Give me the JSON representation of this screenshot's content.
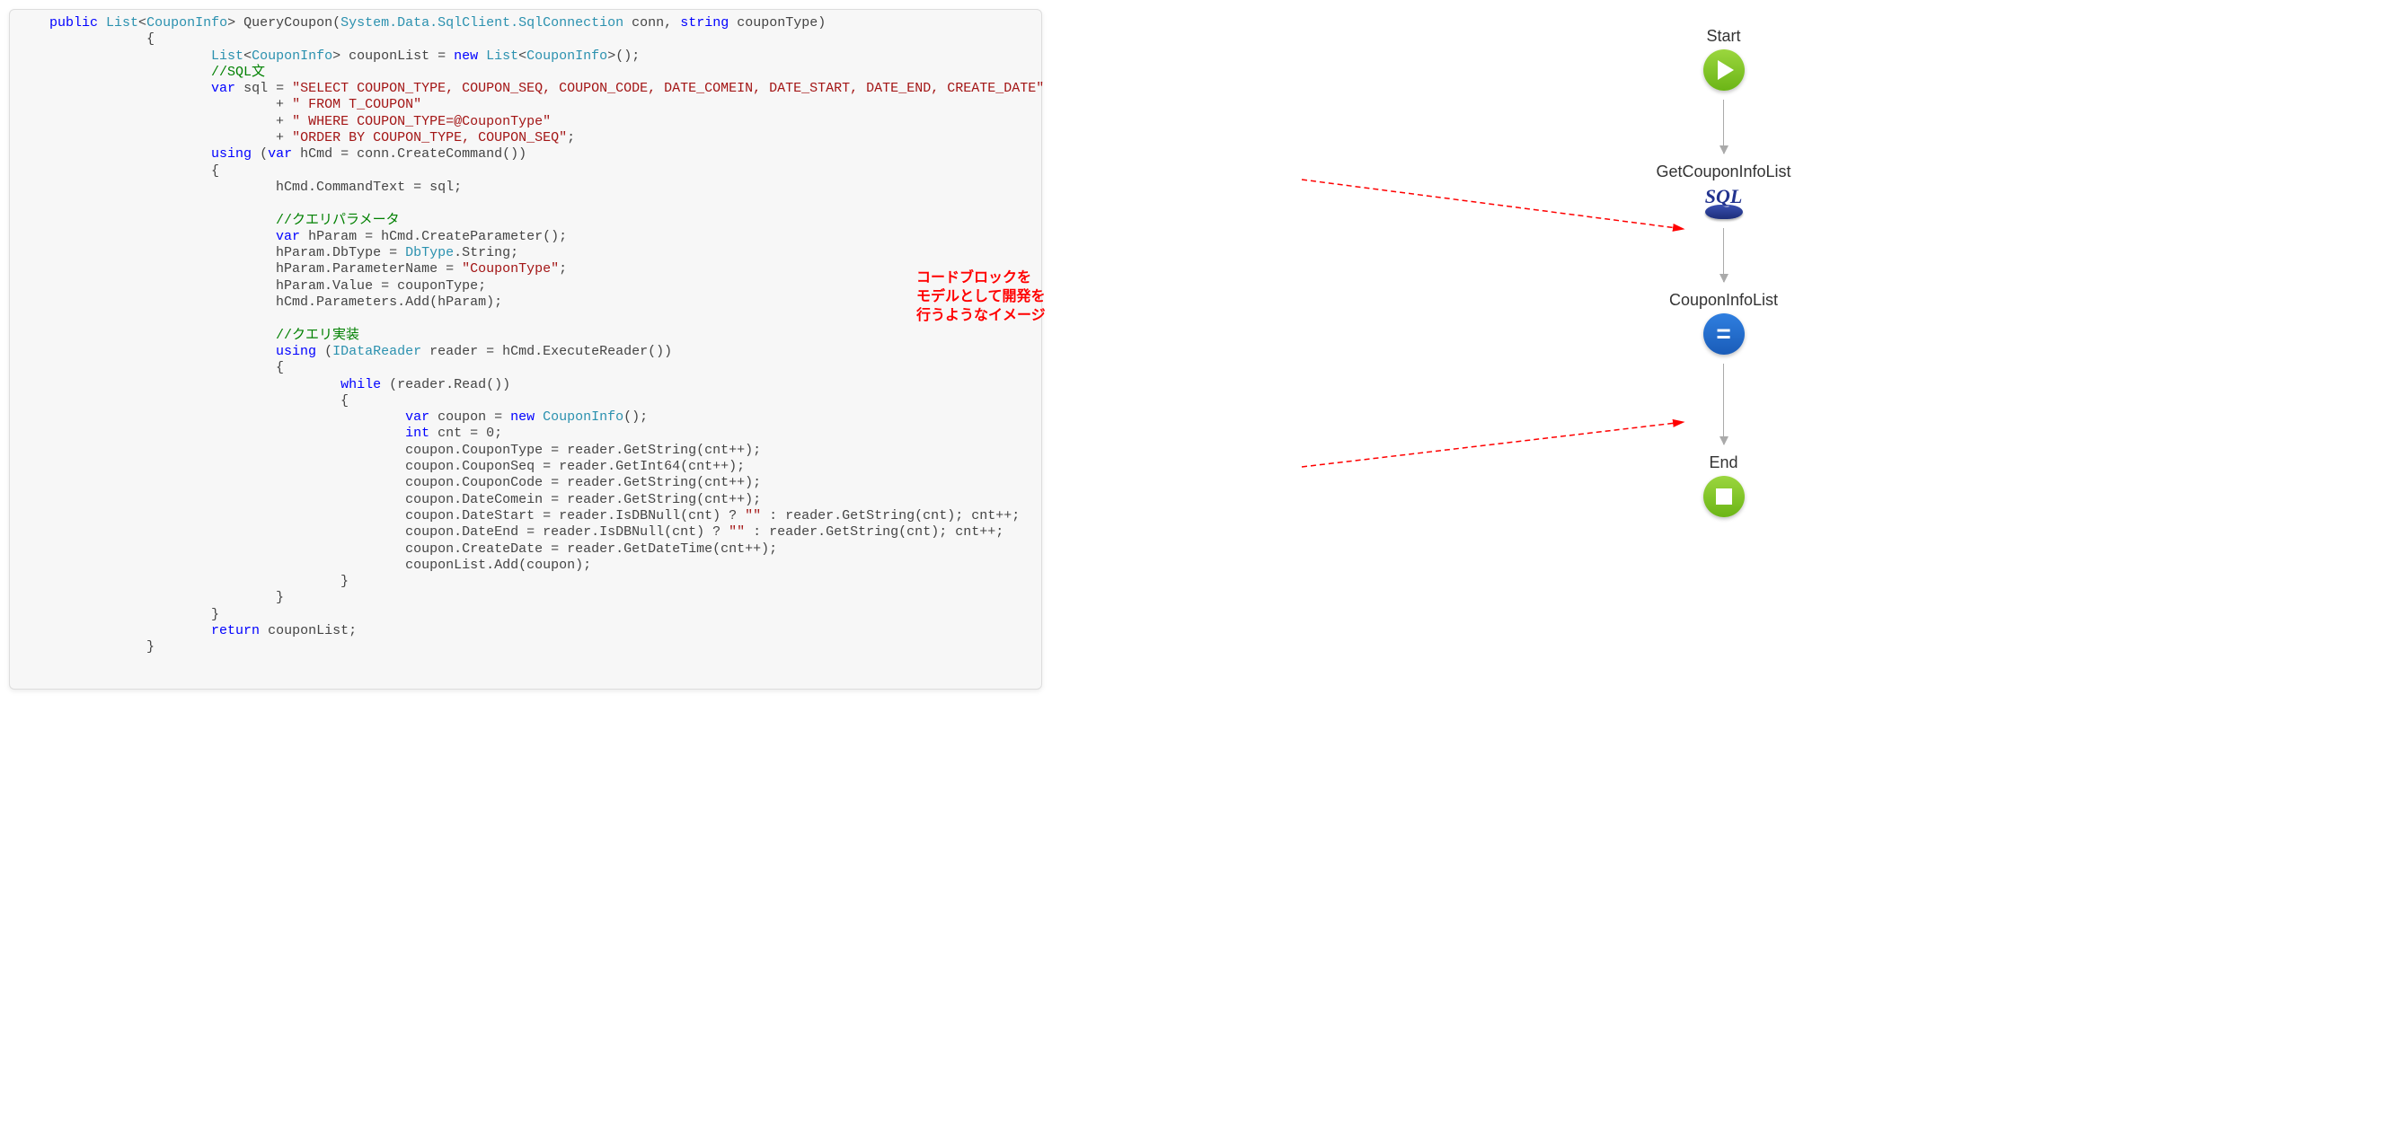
{
  "code_lines": [
    {
      "indent": 1,
      "tokens": [
        {
          "t": "public ",
          "c": "kw"
        },
        {
          "t": "List",
          "c": "type"
        },
        {
          "t": "<"
        },
        {
          "t": "CouponInfo",
          "c": "type"
        },
        {
          "t": "> QueryCoupon("
        },
        {
          "t": "System.Data.SqlClient.SqlConnection",
          "c": "type"
        },
        {
          "t": " conn, "
        },
        {
          "t": "string ",
          "c": "kw"
        },
        {
          "t": "couponType)"
        }
      ]
    },
    {
      "indent": 4,
      "tokens": [
        {
          "t": "{"
        }
      ]
    },
    {
      "indent": 6,
      "tokens": [
        {
          "t": "List",
          "c": "type"
        },
        {
          "t": "<"
        },
        {
          "t": "CouponInfo",
          "c": "type"
        },
        {
          "t": "> couponList = "
        },
        {
          "t": "new ",
          "c": "kw"
        },
        {
          "t": "List",
          "c": "type"
        },
        {
          "t": "<"
        },
        {
          "t": "CouponInfo",
          "c": "type"
        },
        {
          "t": ">();"
        }
      ]
    },
    {
      "indent": 6,
      "tokens": [
        {
          "t": "//SQL文",
          "c": "cmt"
        }
      ]
    },
    {
      "indent": 6,
      "tokens": [
        {
          "t": "var ",
          "c": "kw"
        },
        {
          "t": "sql = "
        },
        {
          "t": "\"SELECT COUPON_TYPE, COUPON_SEQ, COUPON_CODE, DATE_COMEIN, DATE_START, DATE_END, CREATE_DATE\"",
          "c": "str"
        }
      ]
    },
    {
      "indent": 8,
      "tokens": [
        {
          "t": "+ "
        },
        {
          "t": "\" FROM T_COUPON\"",
          "c": "str"
        }
      ]
    },
    {
      "indent": 8,
      "tokens": [
        {
          "t": "+ "
        },
        {
          "t": "\" WHERE COUPON_TYPE=@CouponType\"",
          "c": "str"
        }
      ]
    },
    {
      "indent": 8,
      "tokens": [
        {
          "t": "+ "
        },
        {
          "t": "\"ORDER BY COUPON_TYPE, COUPON_SEQ\"",
          "c": "str"
        },
        {
          "t": ";"
        }
      ]
    },
    {
      "indent": 6,
      "tokens": [
        {
          "t": "using ",
          "c": "kw"
        },
        {
          "t": "("
        },
        {
          "t": "var ",
          "c": "kw"
        },
        {
          "t": "hCmd = conn.CreateCommand())"
        }
      ]
    },
    {
      "indent": 6,
      "tokens": [
        {
          "t": "{"
        }
      ]
    },
    {
      "indent": 8,
      "tokens": [
        {
          "t": "hCmd.CommandText = sql;"
        }
      ]
    },
    {
      "indent": 0,
      "tokens": [
        {
          "t": " "
        }
      ]
    },
    {
      "indent": 8,
      "tokens": [
        {
          "t": "//クエリパラメータ",
          "c": "cmt"
        }
      ]
    },
    {
      "indent": 8,
      "tokens": [
        {
          "t": "var ",
          "c": "kw"
        },
        {
          "t": "hParam = hCmd.CreateParameter();"
        }
      ]
    },
    {
      "indent": 8,
      "tokens": [
        {
          "t": "hParam.DbType = "
        },
        {
          "t": "DbType",
          "c": "type"
        },
        {
          "t": ".String;"
        }
      ]
    },
    {
      "indent": 8,
      "tokens": [
        {
          "t": "hParam.ParameterName = "
        },
        {
          "t": "\"CouponType\"",
          "c": "str"
        },
        {
          "t": ";"
        }
      ]
    },
    {
      "indent": 8,
      "tokens": [
        {
          "t": "hParam.Value = couponType;"
        }
      ]
    },
    {
      "indent": 8,
      "tokens": [
        {
          "t": "hCmd.Parameters.Add(hParam);"
        }
      ]
    },
    {
      "indent": 0,
      "tokens": [
        {
          "t": " "
        }
      ]
    },
    {
      "indent": 8,
      "tokens": [
        {
          "t": "//クエリ実装",
          "c": "cmt"
        }
      ]
    },
    {
      "indent": 8,
      "tokens": [
        {
          "t": "using ",
          "c": "kw"
        },
        {
          "t": "("
        },
        {
          "t": "IDataReader",
          "c": "type"
        },
        {
          "t": " reader = hCmd.ExecuteReader())"
        }
      ]
    },
    {
      "indent": 8,
      "tokens": [
        {
          "t": "{"
        }
      ]
    },
    {
      "indent": 10,
      "tokens": [
        {
          "t": "while ",
          "c": "kw"
        },
        {
          "t": "(reader.Read())"
        }
      ]
    },
    {
      "indent": 10,
      "tokens": [
        {
          "t": "{"
        }
      ]
    },
    {
      "indent": 12,
      "tokens": [
        {
          "t": "var ",
          "c": "kw"
        },
        {
          "t": "coupon = "
        },
        {
          "t": "new ",
          "c": "kw"
        },
        {
          "t": "CouponInfo",
          "c": "type"
        },
        {
          "t": "();"
        }
      ]
    },
    {
      "indent": 12,
      "tokens": [
        {
          "t": "int ",
          "c": "kw"
        },
        {
          "t": "cnt = 0;"
        }
      ]
    },
    {
      "indent": 12,
      "tokens": [
        {
          "t": "coupon.CouponType = reader.GetString(cnt++);"
        }
      ]
    },
    {
      "indent": 12,
      "tokens": [
        {
          "t": "coupon.CouponSeq = reader.GetInt64(cnt++);"
        }
      ]
    },
    {
      "indent": 12,
      "tokens": [
        {
          "t": "coupon.CouponCode = reader.GetString(cnt++);"
        }
      ]
    },
    {
      "indent": 12,
      "tokens": [
        {
          "t": "coupon.DateComein = reader.GetString(cnt++);"
        }
      ]
    },
    {
      "indent": 12,
      "tokens": [
        {
          "t": "coupon.DateStart = reader.IsDBNull(cnt) ? "
        },
        {
          "t": "\"\"",
          "c": "str"
        },
        {
          "t": " : reader.GetString(cnt); cnt++;"
        }
      ]
    },
    {
      "indent": 12,
      "tokens": [
        {
          "t": "coupon.DateEnd = reader.IsDBNull(cnt) ? "
        },
        {
          "t": "\"\"",
          "c": "str"
        },
        {
          "t": " : reader.GetString(cnt); cnt++;"
        }
      ]
    },
    {
      "indent": 12,
      "tokens": [
        {
          "t": "coupon.CreateDate = reader.GetDateTime(cnt++);"
        }
      ]
    },
    {
      "indent": 12,
      "tokens": [
        {
          "t": "couponList.Add(coupon);"
        }
      ]
    },
    {
      "indent": 10,
      "tokens": [
        {
          "t": "}"
        }
      ]
    },
    {
      "indent": 8,
      "tokens": [
        {
          "t": "}"
        }
      ]
    },
    {
      "indent": 6,
      "tokens": [
        {
          "t": "}"
        }
      ]
    },
    {
      "indent": 6,
      "tokens": [
        {
          "t": "return ",
          "c": "kw"
        },
        {
          "t": "couponList;"
        }
      ]
    },
    {
      "indent": 4,
      "tokens": [
        {
          "t": "}"
        }
      ]
    }
  ],
  "flow": {
    "start": "Start",
    "n1": "GetCouponInfoList",
    "sql_label": "SQL",
    "n2": "CouponInfoList",
    "end": "End"
  },
  "annotation": {
    "l1": "コードブロックを",
    "l2": "モデルとして開発を",
    "l3": "行うようなイメージ"
  }
}
